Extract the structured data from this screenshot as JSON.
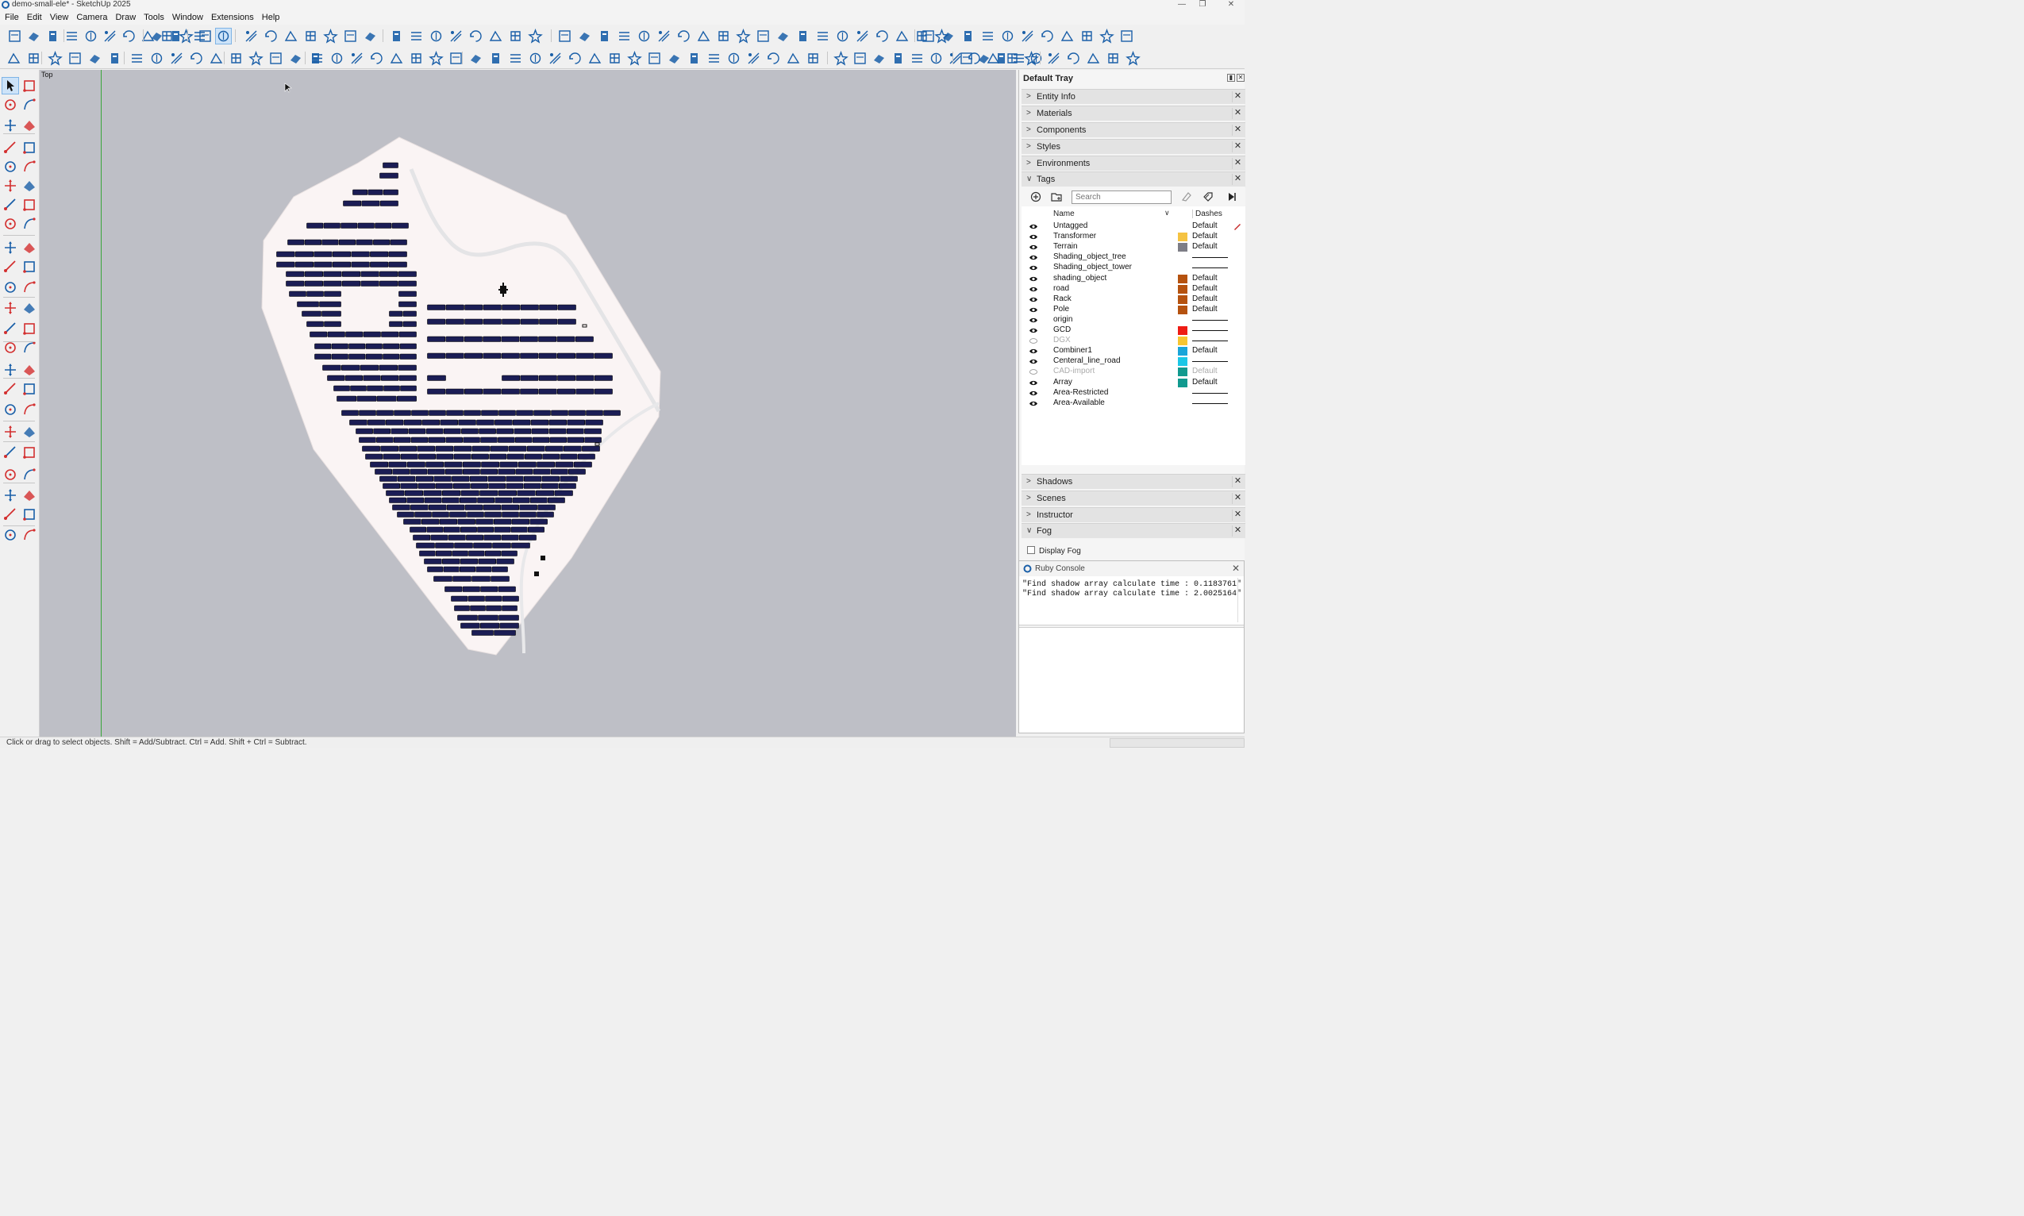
{
  "window": {
    "title": "demo-small-ele* - SketchUp 2025",
    "controls": {
      "minimize": "—",
      "restore": "❐",
      "close": "✕"
    }
  },
  "menubar": [
    "File",
    "Edit",
    "View",
    "Camera",
    "Draw",
    "Tools",
    "Window",
    "Extensions",
    "Help"
  ],
  "viewport": {
    "view_name": "Top",
    "background": "#bebfc6",
    "terrain_color": "#faf5f5",
    "panel_color": "#1b1d55"
  },
  "tray": {
    "title": "Default Tray",
    "panels_top": [
      "Entity Info",
      "Materials",
      "Components",
      "Styles",
      "Environments",
      "Tags"
    ],
    "panels_bottom": [
      "Shadows",
      "Scenes",
      "Instructor",
      "Fog"
    ],
    "fog": {
      "display_fog_label": "Display Fog"
    }
  },
  "tags": {
    "search_placeholder": "Search",
    "col_name": "Name",
    "col_dashes": "Dashes",
    "rows": [
      {
        "name": "Untagged",
        "visible": true,
        "color": "",
        "dashes": "Default"
      },
      {
        "name": "Transformer",
        "visible": true,
        "color": "#f5c342",
        "dashes": "Default"
      },
      {
        "name": "Terrain",
        "visible": true,
        "color": "#7d7d86",
        "dashes": "Default"
      },
      {
        "name": "Shading_object_tree",
        "visible": true,
        "color": "",
        "dashes": ""
      },
      {
        "name": "Shading_object_tower",
        "visible": true,
        "color": "",
        "dashes": ""
      },
      {
        "name": "shading_object",
        "visible": true,
        "color": "#b5520f",
        "dashes": "Default"
      },
      {
        "name": "road",
        "visible": true,
        "color": "#b5520f",
        "dashes": "Default"
      },
      {
        "name": "Rack",
        "visible": true,
        "color": "#b5520f",
        "dashes": "Default"
      },
      {
        "name": "Pole",
        "visible": true,
        "color": "#b5520f",
        "dashes": "Default"
      },
      {
        "name": "origin",
        "visible": true,
        "color": "",
        "dashes": ""
      },
      {
        "name": "GCD",
        "visible": true,
        "color": "#ee1c14",
        "dashes": ""
      },
      {
        "name": "DGX",
        "visible": false,
        "color": "#f7c531",
        "dashes": ""
      },
      {
        "name": "Combiner1",
        "visible": true,
        "color": "#1aa5d9",
        "dashes": "Default"
      },
      {
        "name": "Centeral_line_road",
        "visible": true,
        "color": "#1bc7e6",
        "dashes": ""
      },
      {
        "name": "CAD-import",
        "visible": false,
        "color": "#119a8f",
        "dashes": "Default"
      },
      {
        "name": "Array",
        "visible": true,
        "color": "#119a8f",
        "dashes": "Default"
      },
      {
        "name": "Area-Restricted",
        "visible": true,
        "color": "",
        "dashes": ""
      },
      {
        "name": "Area-Available",
        "visible": true,
        "color": "",
        "dashes": ""
      }
    ]
  },
  "ruby_console": {
    "title": "Ruby Console",
    "output": "\"Find shadow array calculate time : 0.1183761\"\n\"Find shadow array calculate time : 2.0025164\""
  },
  "statusbar": {
    "text": "Click or drag to select objects. Shift = Add/Subtract. Ctrl = Add. Shift + Ctrl = Subtract."
  },
  "icons": {
    "toolbar": [
      "new-icon",
      "open-icon",
      "save-icon",
      "cut-icon",
      "copy-icon",
      "paste-icon",
      "erase-icon",
      "undo-icon",
      "redo-icon",
      "print-icon",
      "model-info-icon",
      "iso-view-icon",
      "top-view-icon",
      "front-view-icon",
      "right-view-icon",
      "back-view-icon",
      "left-view-icon",
      "bottom-view-icon",
      "xray-icon",
      "back-edges-icon",
      "wireframe-icon",
      "hidden-line-icon",
      "shaded-icon",
      "shaded-textures-icon",
      "monochrome-icon",
      "search-icon",
      "protractor-icon",
      "dimension-icon",
      "text-icon",
      "section-icon",
      "lock-icon",
      "terrain-icon",
      "extension-icon",
      "warehouse-icon",
      "settings-icon",
      "help-icon",
      "play-icon"
    ],
    "lefttoolbar": [
      "select-icon",
      "lasso-icon",
      "paint-bucket-icon",
      "eraser-icon",
      "tag-tool-icon",
      "line-icon",
      "freehand-icon",
      "rectangle-icon",
      "circle-icon",
      "arc-icon",
      "move-icon",
      "push-pull-icon",
      "rotate-icon",
      "follow-me-icon",
      "scale-icon",
      "offset-icon",
      "tape-measure-icon",
      "protractor-icon",
      "axes-icon",
      "3d-text-icon",
      "orbit-icon",
      "pan-icon",
      "zoom-icon",
      "zoom-extents-icon",
      "walk-icon",
      "look-around-icon",
      "sandbox-icon"
    ]
  }
}
